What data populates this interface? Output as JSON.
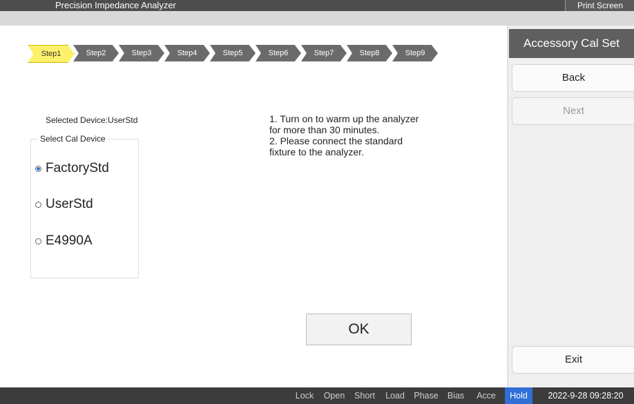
{
  "window": {
    "title": "Precision Impedance Analyzer",
    "print_label": "Print Screen"
  },
  "steps": [
    {
      "label": "Step1",
      "active": true
    },
    {
      "label": "Step2",
      "active": false
    },
    {
      "label": "Step3",
      "active": false
    },
    {
      "label": "Step4",
      "active": false
    },
    {
      "label": "Step5",
      "active": false
    },
    {
      "label": "Step6",
      "active": false
    },
    {
      "label": "Step7",
      "active": false
    },
    {
      "label": "Step8",
      "active": false
    },
    {
      "label": "Step9",
      "active": false
    }
  ],
  "selection": {
    "selected_device": "Selected Device:UserStd",
    "group_title": "Select Cal Device",
    "options": [
      {
        "label": "FactoryStd",
        "checked": true
      },
      {
        "label": "UserStd",
        "checked": false
      },
      {
        "label": "E4990A",
        "checked": false
      }
    ]
  },
  "instructions": [
    "1. Turn on to warm up the analyzer",
    "for more than 30 minutes.",
    "2. Please connect the standard",
    "fixture to the analyzer."
  ],
  "ok_label": "OK",
  "side": {
    "header": "Accessory Cal Set",
    "back_label": "Back",
    "next_label": "Next",
    "exit_label": "Exit"
  },
  "status": {
    "items": [
      "Lock",
      "Open",
      "Short",
      "Load",
      "Phase",
      "Bias",
      "Acce"
    ],
    "hold_label": "Hold",
    "datetime": "2022-9-28 09:28:20"
  },
  "colors": {
    "active_step": "#fdf06a",
    "inactive_step": "#6b6b6b",
    "hold": "#2f6fd6",
    "side_header": "#5f5f5f"
  }
}
